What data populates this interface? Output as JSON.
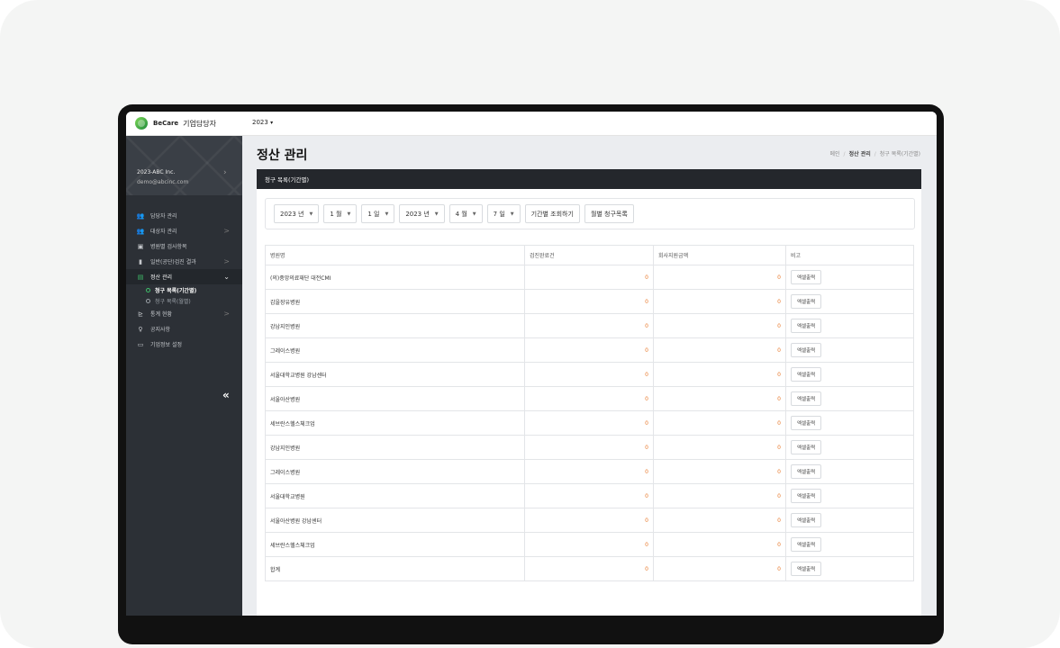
{
  "app": {
    "brand_name": "BeCare",
    "role": "기업담당자",
    "year": "2023",
    "year_caret": "▾"
  },
  "account": {
    "company": "2023-ABC Inc.",
    "email": "demo@abcinc.com"
  },
  "sidebar": {
    "items": [
      {
        "icon": "users-icon",
        "glyph": "👥",
        "label": "담당자 관리",
        "arrow": ""
      },
      {
        "icon": "user-group-icon",
        "glyph": "👥",
        "label": "대상자 관리",
        "arrow": ">"
      },
      {
        "icon": "hospital-icon",
        "glyph": "▣",
        "label": "병원별 검사항목",
        "arrow": ""
      },
      {
        "icon": "clipboard-icon",
        "glyph": "▮",
        "label": "일반(공단)검진 결과",
        "arrow": ">"
      },
      {
        "icon": "calculator-icon",
        "glyph": "▤",
        "label": "정산 관리",
        "arrow": "⌄"
      }
    ],
    "subitems": [
      {
        "label": "청구 목록(기간별)"
      },
      {
        "label": "청구 목록(월별)"
      }
    ],
    "items2": [
      {
        "icon": "chart-icon",
        "glyph": "⊵",
        "label": "통계 현황",
        "arrow": ">"
      },
      {
        "icon": "pin-icon",
        "glyph": "♀",
        "label": "공지사항",
        "arrow": ""
      },
      {
        "icon": "keyboard-icon",
        "glyph": "▭",
        "label": "기업정보 설정",
        "arrow": ""
      }
    ],
    "collapse": "«"
  },
  "page": {
    "title": "정산 관리",
    "breadcrumb": [
      "메인",
      "정산 관리",
      "청구 목록(기간별)"
    ],
    "breadcrumb_sep": "/",
    "panel_title": "청구 목록(기간별)"
  },
  "filters": {
    "start_year": "2023 년",
    "start_month": "1 월",
    "start_day": "1 일",
    "end_year": "2023 년",
    "end_month": "4 월",
    "end_day": "7 일",
    "caret": "▼",
    "search_button": "기간별 조회하기",
    "monthly_button": "월별 청구목록"
  },
  "table": {
    "headers": [
      "병원명",
      "검진완료건",
      "회사지원금액",
      "비고"
    ],
    "export_label": "엑셀출력",
    "rows": [
      {
        "hospital": "(의)중앙의료재단 대전CMI",
        "count": "0",
        "amount": "0"
      },
      {
        "hospital": "갑을장유병원",
        "count": "0",
        "amount": "0"
      },
      {
        "hospital": "강남지인병원",
        "count": "0",
        "amount": "0"
      },
      {
        "hospital": "그레이스병원",
        "count": "0",
        "amount": "0"
      },
      {
        "hospital": "서울대학교병원 강남센터",
        "count": "0",
        "amount": "0"
      },
      {
        "hospital": "서울아산병원",
        "count": "0",
        "amount": "0"
      },
      {
        "hospital": "세브란스헬스체크업",
        "count": "0",
        "amount": "0"
      },
      {
        "hospital": "강남지인병원",
        "count": "0",
        "amount": "0"
      },
      {
        "hospital": "그레이스병원",
        "count": "0",
        "amount": "0"
      },
      {
        "hospital": "서울대학교병원",
        "count": "0",
        "amount": "0"
      },
      {
        "hospital": "서울아산병원 강남센터",
        "count": "0",
        "amount": "0"
      },
      {
        "hospital": "세브란스헬스체크업",
        "count": "0",
        "amount": "0"
      },
      {
        "hospital": "합계",
        "count": "0",
        "amount": "0"
      }
    ]
  }
}
